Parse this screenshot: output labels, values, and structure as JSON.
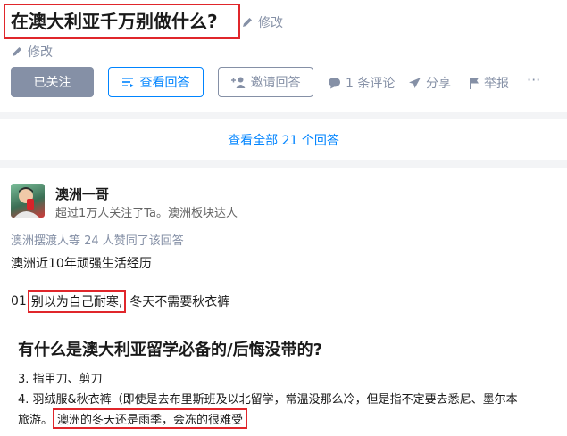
{
  "question": {
    "title": "在澳大利亚千万别做什么?",
    "edit_label": "修改",
    "edit_label_2": "修改"
  },
  "actions": {
    "followed_label": "已关注",
    "view_answers_label": "查看回答",
    "invite_label": "邀请回答",
    "comment_label": "1 条评论",
    "share_label": "分享",
    "report_label": "举报",
    "more_label": "···"
  },
  "view_all_label": "查看全部 21 个回答",
  "answer": {
    "author_name": "澳洲一哥",
    "author_bio": "超过1万人关注了Ta。澳洲板块达人",
    "upvote_text": "澳洲摆渡人等 24 人赞同了该回答",
    "line1": "澳洲近10年顽强生活经历",
    "item_prefix": "01",
    "item_highlight": "别以为自己耐寒,",
    "item_rest": "冬天不需要秋衣裤"
  },
  "second": {
    "heading": "有什么是澳大利亚留学必备的/后悔没带的?",
    "line3": "3. 指甲刀、剪刀",
    "line4": "4. 羽绒服&秋衣裤（即使是去布里斯班及以北留学，常温没那么冷，但是指不定要去悉尼、墨尔本",
    "line5_prefix": "旅游。",
    "line5_highlight": "澳洲的冬天还是雨季，会冻的很难受"
  },
  "colors": {
    "highlight_border": "#e0262b",
    "accent_blue": "#0084ff",
    "muted_gray": "#8590a6"
  },
  "icons": [
    "pencil-icon",
    "list-icon",
    "add-person-icon",
    "comment-icon",
    "paper-plane-icon",
    "flag-icon",
    "more-icon"
  ]
}
